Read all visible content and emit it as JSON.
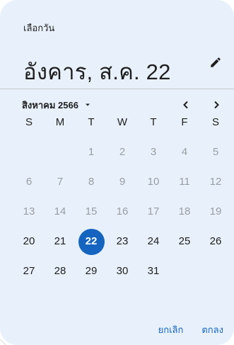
{
  "header": {
    "label": "เลือกวัน",
    "selected_date": "อังคาร, ส.ค. 22",
    "edit_icon": "pencil-icon"
  },
  "nav": {
    "month_year": "สิงหาคม 2566",
    "dropdown_icon": "caret-down-icon",
    "prev_icon": "chevron-left-icon",
    "next_icon": "chevron-right-icon"
  },
  "weekdays": [
    "S",
    "M",
    "T",
    "W",
    "T",
    "F",
    "S"
  ],
  "weeks": [
    [
      "",
      "",
      "1",
      "2",
      "3",
      "4",
      "5"
    ],
    [
      "6",
      "7",
      "8",
      "9",
      "10",
      "11",
      "12"
    ],
    [
      "13",
      "14",
      "15",
      "16",
      "17",
      "18",
      "19"
    ],
    [
      "20",
      "21",
      "22",
      "23",
      "24",
      "25",
      "26"
    ],
    [
      "27",
      "28",
      "29",
      "30",
      "31",
      "",
      ""
    ]
  ],
  "disabled_days": [
    "1",
    "2",
    "3",
    "4",
    "5",
    "6",
    "7",
    "8",
    "9",
    "10",
    "11",
    "12",
    "13",
    "14",
    "15",
    "16",
    "17",
    "18",
    "19"
  ],
  "selected_day": "22",
  "actions": {
    "cancel": "ยกเลิก",
    "ok": "ตกลง"
  },
  "colors": {
    "accent": "#1565c0",
    "surface": "#e8f1fb",
    "disabled_text": "#9a9da3"
  }
}
